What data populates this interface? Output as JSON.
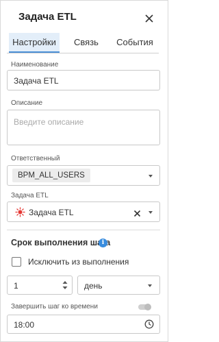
{
  "dialog": {
    "title": "Задача ETL",
    "close_icon": "close-icon"
  },
  "tabs": [
    {
      "label": "Настройки",
      "active": true
    },
    {
      "label": "Связь",
      "active": false
    },
    {
      "label": "События",
      "active": false
    }
  ],
  "form": {
    "name": {
      "label": "Наименование",
      "value": "Задача ETL"
    },
    "description": {
      "label": "Описание",
      "placeholder": "Введите описание"
    },
    "responsible": {
      "label": "Ответственный",
      "value": "BPM_ALL_USERS"
    },
    "etl_task": {
      "label": "Задача ETL",
      "value": "Задача ETL",
      "icon": "etl-task-icon"
    }
  },
  "deadline": {
    "title": "Срок выполнения шага",
    "info_icon": "info-icon",
    "exclude": {
      "label": "Исключить из выполнения",
      "checked": false
    },
    "amount": "1",
    "unit": "день",
    "finish_by_time": {
      "label": "Завершить шаг ко времени",
      "enabled": false
    },
    "time": "18:00",
    "time_icon": "clock-icon"
  },
  "colors": {
    "accent": "#4a8fd6",
    "active_tab_bg": "#e3eef9",
    "info": "#3a8dde",
    "etl_icon": "#e53935"
  }
}
